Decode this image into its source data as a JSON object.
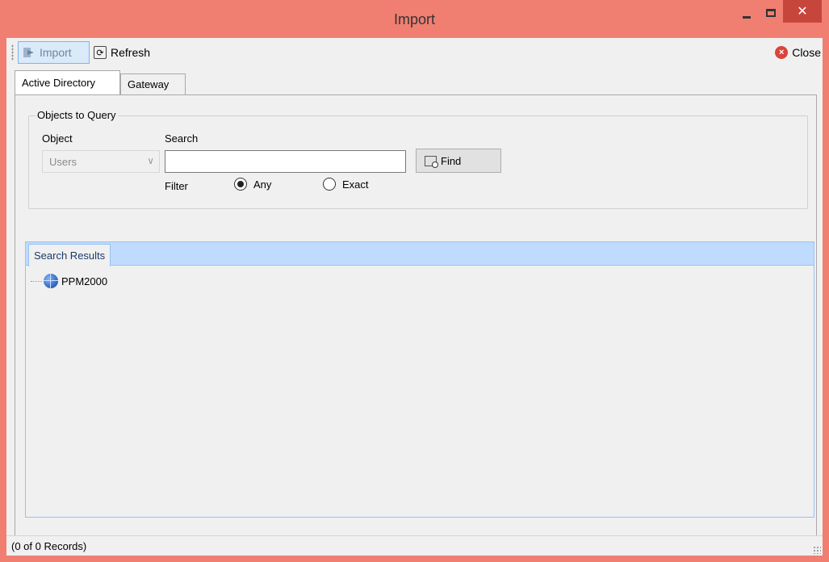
{
  "window": {
    "title": "Import",
    "close_glyph": "✕"
  },
  "toolbar": {
    "import_label": "Import",
    "import_icon": "import-arrow-icon",
    "refresh_label": "Refresh",
    "refresh_icon": "refresh-icon",
    "close_label": "Close",
    "close_icon": "close-circle-icon"
  },
  "tabs": [
    {
      "label": "Active Directory",
      "selected": true
    },
    {
      "label": "Gateway",
      "selected": false
    }
  ],
  "query_group": {
    "legend": "Objects to Query",
    "object_label": "Object",
    "object_value": "Users",
    "search_label": "Search",
    "search_value": "",
    "find_label": "Find",
    "filter_label": "Filter",
    "filter_options": [
      {
        "label": "Any",
        "checked": true
      },
      {
        "label": "Exact",
        "checked": false
      }
    ]
  },
  "results": {
    "tab_label": "Search Results",
    "tree": [
      {
        "label": "PPM2000",
        "icon": "globe-icon"
      }
    ]
  },
  "status": {
    "text": "(0 of 0 Records)"
  },
  "colors": {
    "titlebar": "#f07f72",
    "close_button": "#c7463c",
    "results_header": "#bfdbff"
  }
}
